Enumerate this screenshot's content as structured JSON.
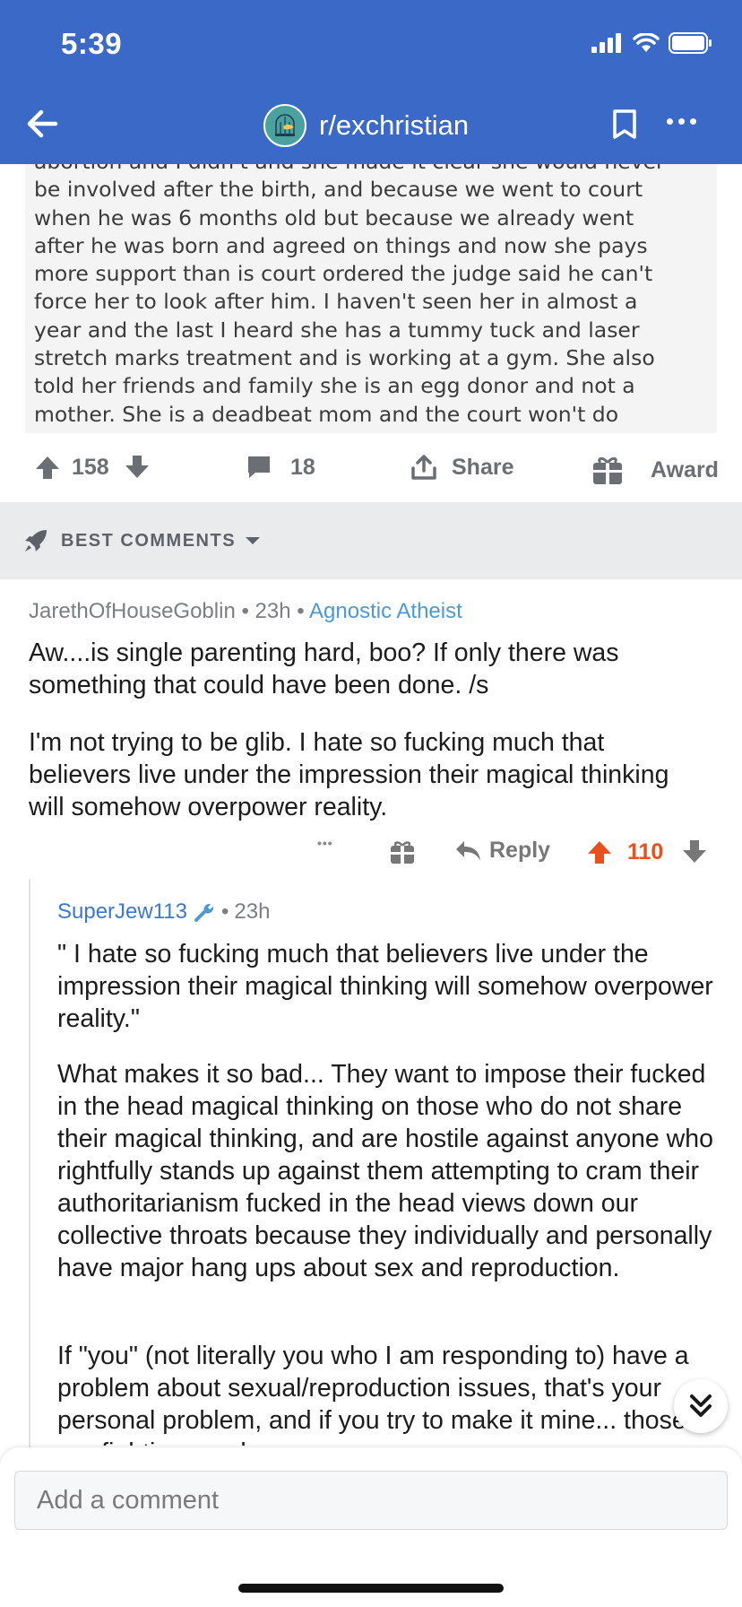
{
  "status_bar": {
    "time": "5:39"
  },
  "header": {
    "subreddit": "r/exchristian"
  },
  "post": {
    "image_text_lines": [
      "abortion and I didn't and she made it clear she would never",
      "be involved after the birth, and because we went to court",
      "when he was 6 months old but because we already went",
      "after he was born and agreed on things and now she pays",
      "more support than is court ordered the judge said he can't",
      "force her to look after him. I haven't seen her in almost a",
      "year and the last I heard she has a tummy tuck and laser",
      "stretch marks treatment and is working at a gym. She also",
      "told her friends and family she is an egg donor and not a",
      "mother. She is a deadbeat mom and the court won't do"
    ],
    "upvotes": "158",
    "comments": "18",
    "share_label": "Share",
    "award_label": "Award"
  },
  "sort": {
    "label": "BEST COMMENTS"
  },
  "comment1": {
    "author": "JarethOfHouseGoblin",
    "age": "23h",
    "flair": "Agnostic Atheist",
    "paragraphs": [
      "Aw....is single parenting hard, boo?  If only there was something that could have been done.  /s",
      "I'm not trying to be glib.  I hate so fucking much that believers live under the impression their magical thinking will somehow overpower reality."
    ],
    "more": "•••",
    "reply_label": "Reply",
    "score": "110"
  },
  "comment2": {
    "author": "SuperJew113",
    "age": "23h",
    "paragraphs": [
      "\"  I hate so fucking much that believers live under the impression their magical thinking will somehow overpower reality.\"",
      "What makes it so bad... They want to impose their fucked in the head magical thinking on those who do not share their magical thinking, and are hostile against anyone who rightfully stands up against them attempting to cram their authoritarianism fucked in the head views down our collective throats because they individually and personally have major hang ups about sex and reproduction.",
      "If \"you\" (not literally you who I am responding to) have a problem about sexual/reproduction issues, that's your personal problem, and if you try to make it mine... those are fighting words."
    ]
  },
  "composer": {
    "placeholder": "Add a comment"
  },
  "colors": {
    "header_bg": "#3a69c7",
    "upvote_active": "#e8501f",
    "flair": "#4b9ad6",
    "user_link": "#3b78d6"
  }
}
